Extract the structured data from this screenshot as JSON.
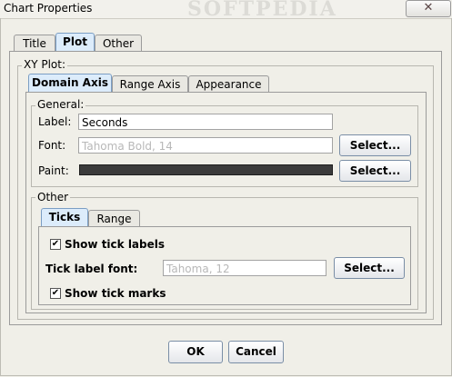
{
  "window": {
    "title": "Chart Properties",
    "watermark": "SOFTPEDIA",
    "close_icon": "close-x-icon",
    "close_glyph": "✕"
  },
  "top_tabs": [
    {
      "label": "Title",
      "selected": false
    },
    {
      "label": "Plot",
      "selected": true
    },
    {
      "label": "Other",
      "selected": false
    }
  ],
  "xy_plot": {
    "title": "XY Plot:",
    "axis_tabs": [
      {
        "label": "Domain Axis",
        "selected": true
      },
      {
        "label": "Range Axis",
        "selected": false
      },
      {
        "label": "Appearance",
        "selected": false
      }
    ],
    "general": {
      "title": "General:",
      "label_caption": "Label:",
      "label_value": "Seconds",
      "font_caption": "Font:",
      "font_value": "Tahoma Bold, 14",
      "font_button": "Select...",
      "paint_caption": "Paint:",
      "paint_color": "#3b3b3b",
      "paint_button": "Select..."
    },
    "other": {
      "title": "Other",
      "tabs": [
        {
          "label": "Ticks",
          "selected": true
        },
        {
          "label": "Range",
          "selected": false
        }
      ],
      "show_tick_labels": {
        "label": "Show tick labels",
        "checked": true,
        "glyph": "✔"
      },
      "tick_font_caption": "Tick label font:",
      "tick_font_value": "Tahoma, 12",
      "tick_font_button": "Select...",
      "show_tick_marks": {
        "label": "Show tick marks",
        "checked": true,
        "glyph": "✔"
      }
    }
  },
  "buttons": {
    "ok": "OK",
    "cancel": "Cancel"
  },
  "colors": {
    "dialog_bg": "#f0efe8",
    "selected_tab_accent": "#dcecfb",
    "button_border": "#7a8ea6"
  }
}
